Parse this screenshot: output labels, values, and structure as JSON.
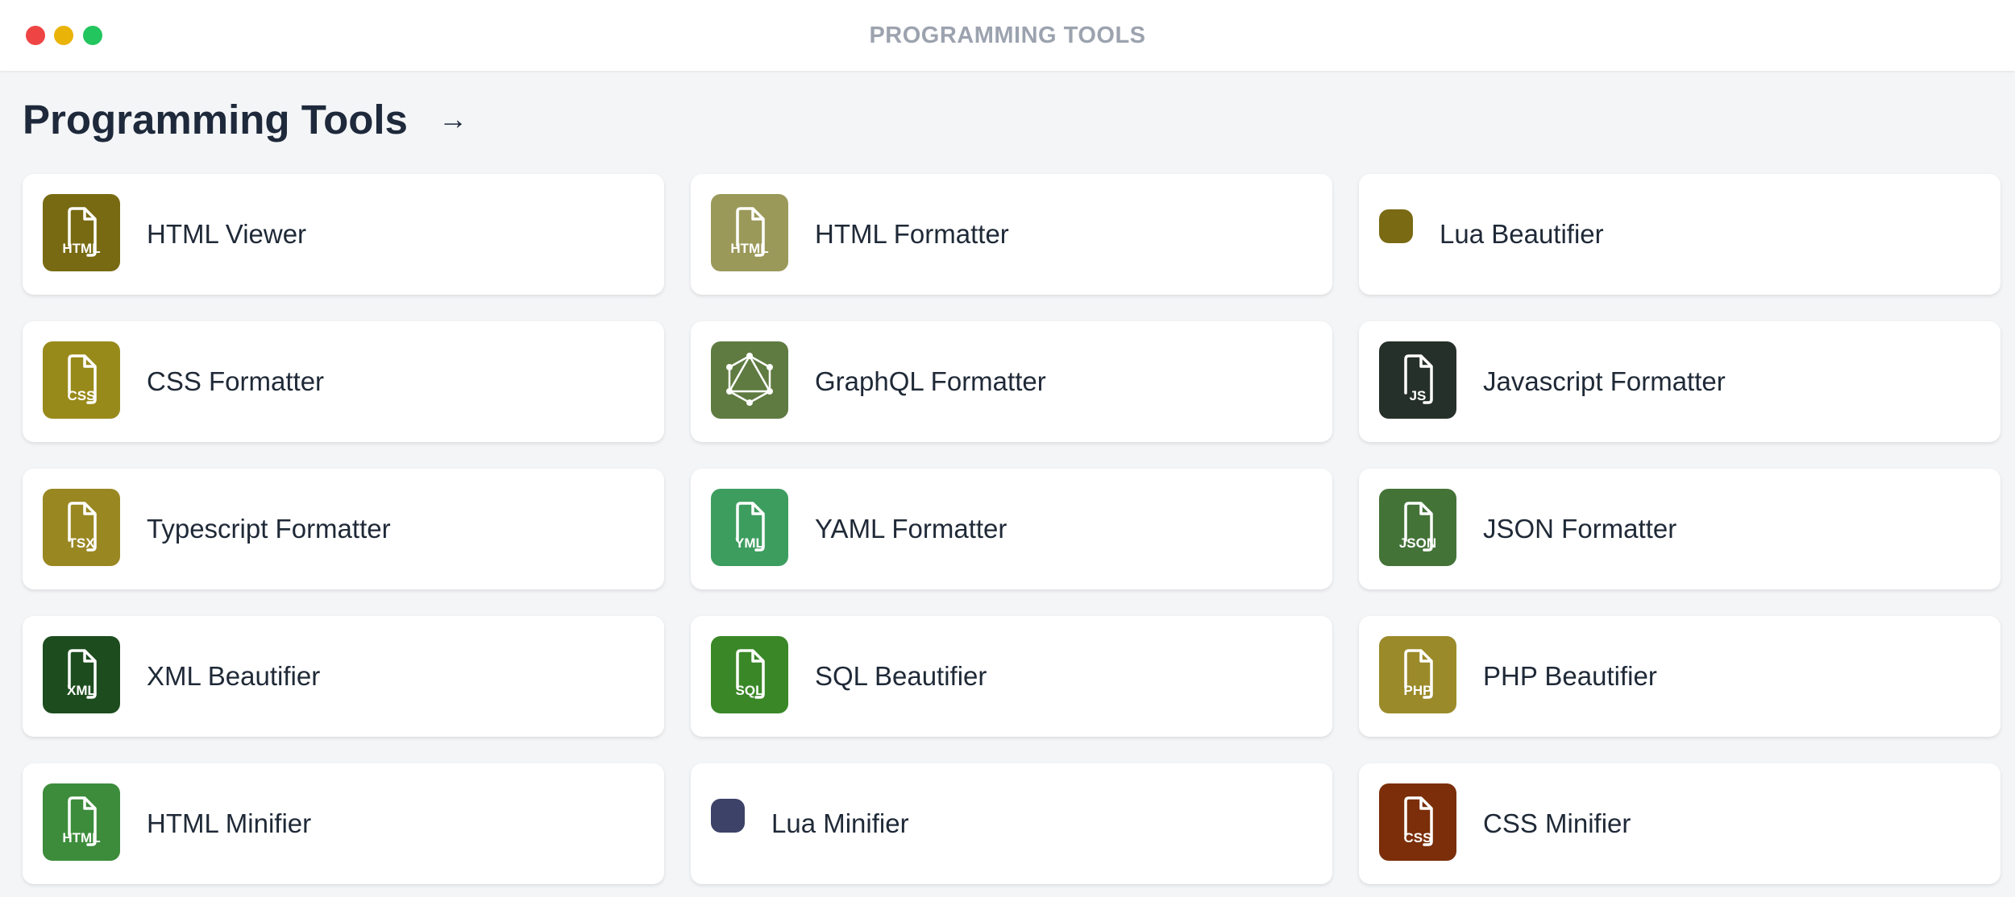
{
  "window": {
    "title": "PROGRAMMING TOOLS"
  },
  "header": {
    "title": "Programming Tools",
    "arrow": "→"
  },
  "tools": [
    {
      "label": "HTML Viewer",
      "icon": "file-icon",
      "badge": "HTML",
      "color": "#786a12",
      "variant": "file"
    },
    {
      "label": "HTML Formatter",
      "icon": "file-icon",
      "badge": "HTML",
      "color": "#9b995a",
      "variant": "file"
    },
    {
      "label": "Lua Beautifier",
      "icon": "lua-icon",
      "badge": "",
      "color": "#7a6a14",
      "variant": "dot"
    },
    {
      "label": "CSS Formatter",
      "icon": "file-icon",
      "badge": "CSS",
      "color": "#988a1a",
      "variant": "file"
    },
    {
      "label": "GraphQL Formatter",
      "icon": "graphql-icon",
      "badge": "",
      "color": "#5f7b41",
      "variant": "graphql"
    },
    {
      "label": "Javascript Formatter",
      "icon": "file-icon",
      "badge": "JS",
      "color": "#26302a",
      "variant": "file"
    },
    {
      "label": "Typescript Formatter",
      "icon": "file-icon",
      "badge": "TSX",
      "color": "#998722",
      "variant": "file"
    },
    {
      "label": "YAML Formatter",
      "icon": "file-icon",
      "badge": "YML",
      "color": "#3d9d5f",
      "variant": "file"
    },
    {
      "label": "JSON Formatter",
      "icon": "file-icon",
      "badge": "JSON",
      "color": "#447338",
      "variant": "file"
    },
    {
      "label": "XML Beautifier",
      "icon": "file-icon",
      "badge": "XML",
      "color": "#1d4d1e",
      "variant": "file"
    },
    {
      "label": "SQL Beautifier",
      "icon": "file-icon",
      "badge": "SQL",
      "color": "#3a8727",
      "variant": "file"
    },
    {
      "label": "PHP Beautifier",
      "icon": "file-icon",
      "badge": "PHP",
      "color": "#9b8a2a",
      "variant": "file"
    },
    {
      "label": "HTML Minifier",
      "icon": "file-icon",
      "badge": "HTML",
      "color": "#3c8c3b",
      "variant": "file"
    },
    {
      "label": "Lua Minifier",
      "icon": "lua-icon",
      "badge": "",
      "color": "#3c4268",
      "variant": "dot"
    },
    {
      "label": "CSS Minifier",
      "icon": "file-icon",
      "badge": "CSS",
      "color": "#7b2e09",
      "variant": "file"
    }
  ]
}
